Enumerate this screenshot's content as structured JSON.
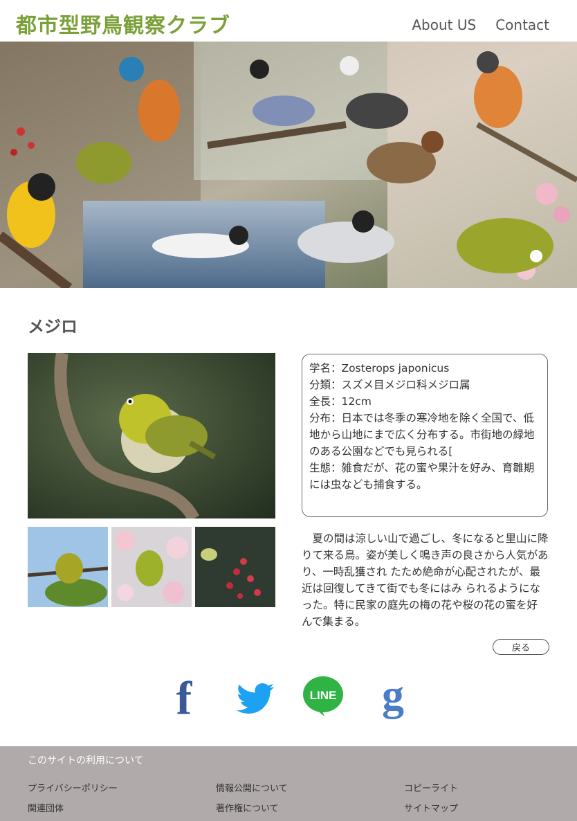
{
  "header": {
    "logo": "都市型野鳥観察クラブ",
    "nav": [
      {
        "label": "About US"
      },
      {
        "label": "Contact"
      }
    ]
  },
  "bird": {
    "name": "メジロ",
    "info_lines": [
      "学名：Zosterops japonicus",
      "分類：スズメ目メジロ科メジロ属",
      "全長：12cm",
      "分布：日本では冬季の寒冷地を除く全国で、低地から山地にまで広く分布する。市街地の緑地のある公園などでも見られる[",
      "生態：雑食だが、花の蜜や果汁を好み、育雛期には虫なども捕食する。"
    ],
    "description": "夏の間は涼しい山で過ごし、冬になると里山に降りて来る鳥。姿が美しく鳴き声の良さから人気があり、一時乱獲され たため絶命が心配されたが、最近は回復してきて街でも冬にはみ られるようになった。特に民家の庭先の梅の花や桜の花の蜜を好 んで集まる。",
    "back_label": "戻る"
  },
  "social": [
    {
      "name": "facebook-icon",
      "glyph": "f",
      "color": "#3b5998"
    },
    {
      "name": "twitter-icon",
      "color": "#1da1f2"
    },
    {
      "name": "line-icon",
      "glyph": "LINE",
      "color": "#2fb344"
    },
    {
      "name": "google-icon",
      "glyph": "g",
      "color": "#4a7cc9"
    }
  ],
  "footer": {
    "title": "このサイトの利用について",
    "links": [
      [
        "プライバシーポリシー",
        "情報公開について",
        "コピーライト"
      ],
      [
        "関連団体",
        "著作権について",
        "サイトマップ"
      ]
    ]
  },
  "colors": {
    "accent": "#7ba03a",
    "footer_bg": "#b0aaaa"
  }
}
